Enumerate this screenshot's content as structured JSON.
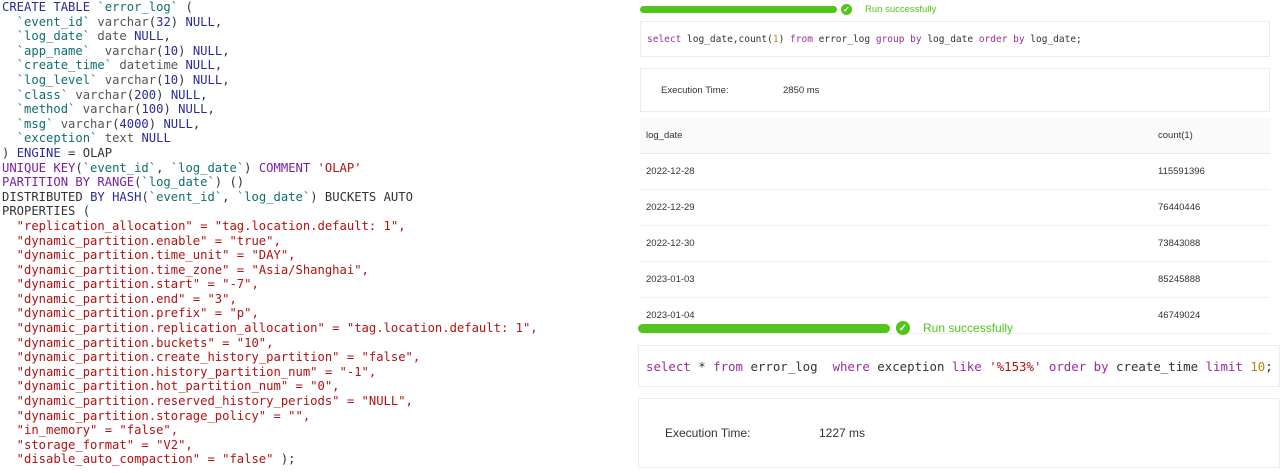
{
  "ddl": {
    "lines": [
      [
        [
          "kw",
          "CREATE TABLE "
        ],
        [
          "id",
          "`error_log`"
        ],
        [
          "pl",
          " ("
        ]
      ],
      [
        [
          "pl",
          "  "
        ],
        [
          "id",
          "`event_id`"
        ],
        [
          "ty",
          " varchar"
        ],
        [
          "pl",
          "("
        ],
        [
          "nu",
          "32"
        ],
        [
          "pl",
          ") "
        ],
        [
          "kw",
          "NULL"
        ],
        [
          "pl",
          ","
        ]
      ],
      [
        [
          "pl",
          "  "
        ],
        [
          "id",
          "`log_date`"
        ],
        [
          "ty",
          " date "
        ],
        [
          "kw",
          "NULL"
        ],
        [
          "pl",
          ","
        ]
      ],
      [
        [
          "pl",
          "  "
        ],
        [
          "id",
          "`app_name`"
        ],
        [
          "ty",
          "  varchar"
        ],
        [
          "pl",
          "("
        ],
        [
          "nu",
          "10"
        ],
        [
          "pl",
          ") "
        ],
        [
          "kw",
          "NULL"
        ],
        [
          "pl",
          ","
        ]
      ],
      [
        [
          "pl",
          "  "
        ],
        [
          "id",
          "`create_time`"
        ],
        [
          "ty",
          " datetime "
        ],
        [
          "kw",
          "NULL"
        ],
        [
          "pl",
          ","
        ]
      ],
      [
        [
          "pl",
          "  "
        ],
        [
          "id",
          "`log_level`"
        ],
        [
          "ty",
          " varchar"
        ],
        [
          "pl",
          "("
        ],
        [
          "nu",
          "10"
        ],
        [
          "pl",
          ") "
        ],
        [
          "kw",
          "NULL"
        ],
        [
          "pl",
          ","
        ]
      ],
      [
        [
          "pl",
          "  "
        ],
        [
          "id",
          "`class`"
        ],
        [
          "ty",
          " varchar"
        ],
        [
          "pl",
          "("
        ],
        [
          "nu",
          "200"
        ],
        [
          "pl",
          ") "
        ],
        [
          "kw",
          "NULL"
        ],
        [
          "pl",
          ","
        ]
      ],
      [
        [
          "pl",
          "  "
        ],
        [
          "id",
          "`method`"
        ],
        [
          "ty",
          " varchar"
        ],
        [
          "pl",
          "("
        ],
        [
          "nu",
          "100"
        ],
        [
          "pl",
          ") "
        ],
        [
          "kw",
          "NULL"
        ],
        [
          "pl",
          ","
        ]
      ],
      [
        [
          "pl",
          "  "
        ],
        [
          "id",
          "`msg`"
        ],
        [
          "ty",
          " varchar"
        ],
        [
          "pl",
          "("
        ],
        [
          "nu",
          "4000"
        ],
        [
          "pl",
          ") "
        ],
        [
          "kw",
          "NULL"
        ],
        [
          "pl",
          ","
        ]
      ],
      [
        [
          "pl",
          "  "
        ],
        [
          "id",
          "`exception`"
        ],
        [
          "ty",
          " text "
        ],
        [
          "kw",
          "NULL"
        ]
      ],
      [
        [
          "pl",
          ") "
        ],
        [
          "kw",
          "ENGINE"
        ],
        [
          "pl",
          " = OLAP"
        ]
      ],
      [
        [
          "pu",
          "UNIQUE KEY"
        ],
        [
          "pl",
          "("
        ],
        [
          "id",
          "`event_id`"
        ],
        [
          "pl",
          ", "
        ],
        [
          "id",
          "`log_date`"
        ],
        [
          "pl",
          ") "
        ],
        [
          "pu",
          "COMMENT "
        ],
        [
          "st",
          "'OLAP'"
        ]
      ],
      [
        [
          "pu",
          "PARTITION BY RANGE"
        ],
        [
          "pl",
          "("
        ],
        [
          "id",
          "`log_date`"
        ],
        [
          "pl",
          ") ()"
        ]
      ],
      [
        [
          "pl",
          "DISTRIBUTED "
        ],
        [
          "kw",
          "BY HASH"
        ],
        [
          "pl",
          "("
        ],
        [
          "id",
          "`event_id`"
        ],
        [
          "pl",
          ", "
        ],
        [
          "id",
          "`log_date`"
        ],
        [
          "pl",
          ") BUCKETS AUTO"
        ]
      ],
      [
        [
          "pl",
          "PROPERTIES ("
        ]
      ],
      [
        [
          "st",
          "  \"replication_allocation\" = \"tag.location.default: 1\","
        ]
      ],
      [
        [
          "st",
          "  \"dynamic_partition.enable\" = \"true\","
        ]
      ],
      [
        [
          "st",
          "  \"dynamic_partition.time_unit\" = \"DAY\","
        ]
      ],
      [
        [
          "st",
          "  \"dynamic_partition.time_zone\" = \"Asia/Shanghai\","
        ]
      ],
      [
        [
          "st",
          "  \"dynamic_partition.start\" = \"-7\","
        ]
      ],
      [
        [
          "st",
          "  \"dynamic_partition.end\" = \"3\","
        ]
      ],
      [
        [
          "st",
          "  \"dynamic_partition.prefix\" = \"p\","
        ]
      ],
      [
        [
          "st",
          "  \"dynamic_partition.replication_allocation\" = \"tag.location.default: 1\","
        ]
      ],
      [
        [
          "st",
          "  \"dynamic_partition.buckets\" = \"10\","
        ]
      ],
      [
        [
          "st",
          "  \"dynamic_partition.create_history_partition\" = \"false\","
        ]
      ],
      [
        [
          "st",
          "  \"dynamic_partition.history_partition_num\" = \"-1\","
        ]
      ],
      [
        [
          "st",
          "  \"dynamic_partition.hot_partition_num\" = \"0\","
        ]
      ],
      [
        [
          "st",
          "  \"dynamic_partition.reserved_history_periods\" = \"NULL\","
        ]
      ],
      [
        [
          "st",
          "  \"dynamic_partition.storage_policy\" = \"\","
        ]
      ],
      [
        [
          "st",
          "  \"in_memory\" = \"false\","
        ]
      ],
      [
        [
          "st",
          "  \"storage_format\" = \"V2\","
        ]
      ],
      [
        [
          "st",
          "  \"disable_auto_compaction\" = \"false\""
        ],
        [
          "pl",
          " );"
        ]
      ]
    ]
  },
  "query1": {
    "status_text": "Run successfully",
    "sql": [
      [
        "sql-kw",
        "select "
      ],
      [
        "sql-fn",
        "log_date,count("
      ],
      [
        "sql-nu",
        "1"
      ],
      [
        "sql-fn",
        ") "
      ],
      [
        "sql-kw",
        "from "
      ],
      [
        "sql-fn",
        "error_log "
      ],
      [
        "sql-kw",
        "group by "
      ],
      [
        "sql-fn",
        "log_date "
      ],
      [
        "sql-kw",
        "order by "
      ],
      [
        "sql-fn",
        "log_date;"
      ]
    ],
    "exec_label": "Execution Time:",
    "exec_value": "2850 ms",
    "columns": [
      "log_date",
      "count(1)"
    ],
    "rows": [
      [
        "2022-12-28",
        "115591396"
      ],
      [
        "2022-12-29",
        "76440446"
      ],
      [
        "2022-12-30",
        "73843088"
      ],
      [
        "2023-01-03",
        "85245888"
      ],
      [
        "2023-01-04",
        "46749024"
      ]
    ]
  },
  "query2": {
    "status_text": "Run successfully",
    "sql": [
      [
        "sql-kw",
        "select "
      ],
      [
        "sql-fn",
        "* "
      ],
      [
        "sql-kw",
        "from "
      ],
      [
        "sql-fn",
        "error_log  "
      ],
      [
        "sql-kw",
        "where "
      ],
      [
        "sql-fn",
        "exception "
      ],
      [
        "sql-kw",
        "like "
      ],
      [
        "sql-st",
        "'%153%' "
      ],
      [
        "sql-kw",
        "order by "
      ],
      [
        "sql-fn",
        "create_time "
      ],
      [
        "sql-kw",
        "limit "
      ],
      [
        "sql-nu",
        "10"
      ],
      [
        "sql-fn",
        ";"
      ]
    ],
    "exec_label": "Execution Time:",
    "exec_value": "1227 ms"
  },
  "colors": {
    "success": "#52c41a"
  },
  "icons": {
    "status": "check-circle-icon"
  }
}
